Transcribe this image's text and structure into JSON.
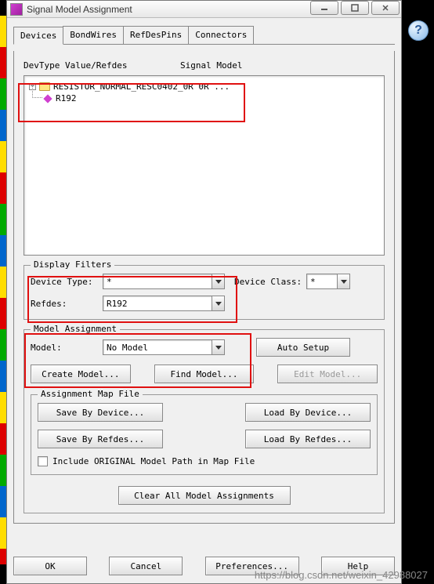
{
  "window": {
    "title": "Signal Model Assignment"
  },
  "tabs": {
    "devices": "Devices",
    "bondwires": "BondWires",
    "refdespins": "RefDesPins",
    "connectors": "Connectors"
  },
  "columns": {
    "devtype": "DevType Value/Refdes",
    "sigmodel": "Signal Model"
  },
  "tree": {
    "root": "RESISTOR_NORMAL_RESC0402_0R 0R ...",
    "child": "R192"
  },
  "filters": {
    "legend": "Display Filters",
    "device_type_label": "Device Type:",
    "device_type_value": "*",
    "device_class_label": "Device Class:",
    "device_class_value": "*",
    "refdes_label": "Refdes:",
    "refdes_value": "R192"
  },
  "model_assignment": {
    "legend": "Model Assignment",
    "model_label": "Model:",
    "model_value": "No Model",
    "auto_setup": "Auto Setup",
    "create_model": "Create Model...",
    "find_model": "Find Model...",
    "edit_model": "Edit Model..."
  },
  "map_file": {
    "legend": "Assignment Map File",
    "save_by_device": "Save By Device...",
    "load_by_device": "Load By Device...",
    "save_by_refdes": "Save By Refdes...",
    "load_by_refdes": "Load By Refdes...",
    "include_original": "Include ORIGINAL Model Path in Map File"
  },
  "footer": {
    "clear_all": "Clear All Model Assignments",
    "ok": "OK",
    "cancel": "Cancel",
    "preferences": "Preferences...",
    "help": "Help"
  },
  "watermark": "https://blog.csdn.net/weixin_42988027"
}
